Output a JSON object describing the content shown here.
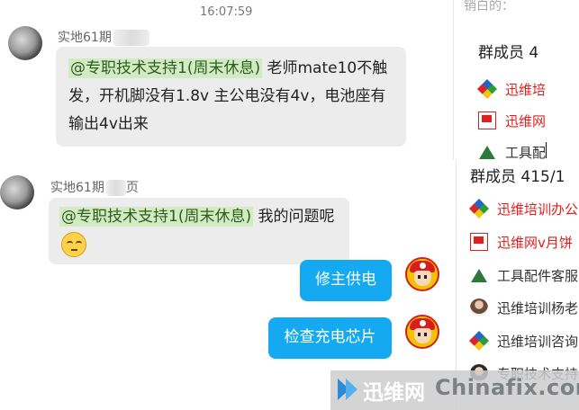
{
  "top": {
    "timestamp": "16:07:59",
    "sender": "实地61期",
    "mention": "@专职技术支持1(周末休息)",
    "message_line1": " 老师mate10不触",
    "message_line2": "发，开机脚没有1.8v 主公电没有4v，电池座有",
    "message_line3": "输出4v出来",
    "search_hint": "销白的：",
    "members_title": "群成员 4",
    "members": [
      {
        "label": "迅维培",
        "color": "#e02020",
        "icon": "colorful-house-icon"
      },
      {
        "label": "迅维网",
        "color": "#e02020",
        "icon": "red-flag-icon"
      },
      {
        "label": "工具配",
        "color": "#333333",
        "icon": "mountain-icon"
      }
    ]
  },
  "bottom": {
    "sender": "实地61期",
    "sender_suffix": "页",
    "mention": "@专职技术支持1(周末休息)",
    "message": " 我的问题呢",
    "emoji": "smirk-emoji",
    "reply1": "修主供电",
    "reply2": "检查充电芯片",
    "members_title": "群成员 415/1",
    "members": [
      {
        "label": "迅维培训办公",
        "color": "#e02020",
        "icon": "colorful-house-icon"
      },
      {
        "label": "迅维网v月饼",
        "color": "#e02020",
        "icon": "red-flag-icon"
      },
      {
        "label": "工具配件客服",
        "color": "#333333",
        "icon": "mountain-icon"
      },
      {
        "label": "迅维培训杨老",
        "color": "#333333",
        "icon": "person-avatar-icon"
      },
      {
        "label": "迅维培训咨询",
        "color": "#333333",
        "icon": "colorful-house-icon"
      },
      {
        "label": "专职技术支持",
        "color": "#333333",
        "icon": "cartoon-avatar-icon"
      }
    ]
  },
  "watermark": {
    "cn": "迅维网",
    "en": "Chinafix.com"
  },
  "colors": {
    "my_bubble": "#14a9f0",
    "peer_bubble": "#ececec",
    "mention_bg": "#d3ebc4",
    "member_red": "#e02020"
  }
}
